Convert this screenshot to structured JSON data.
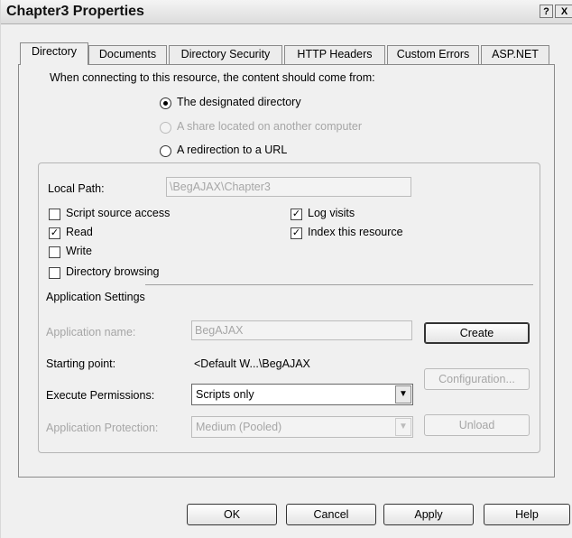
{
  "window": {
    "title": "Chapter3 Properties",
    "help_btn": "?",
    "close_btn": "X"
  },
  "tabs": [
    {
      "label": "Directory",
      "active": true
    },
    {
      "label": "Documents"
    },
    {
      "label": "Directory Security"
    },
    {
      "label": "HTTP Headers"
    },
    {
      "label": "Custom Errors"
    },
    {
      "label": "ASP.NET"
    }
  ],
  "content_source": {
    "prompt": "When connecting to this resource, the content should come from:",
    "options": [
      {
        "label": "The designated directory",
        "selected": true
      },
      {
        "label": "A share located on another computer",
        "disabled": true
      },
      {
        "label": "A redirection to a URL"
      }
    ]
  },
  "local_path": {
    "label": "Local Path:",
    "value": "\\BegAJAX\\Chapter3"
  },
  "checkboxes": [
    {
      "label": "Script source access",
      "checked": false
    },
    {
      "label": "Read",
      "checked": true
    },
    {
      "label": "Write",
      "checked": false
    },
    {
      "label": "Directory browsing",
      "checked": false
    },
    {
      "label": "Log visits",
      "checked": true
    },
    {
      "label": "Index this resource",
      "checked": true
    }
  ],
  "app_settings": {
    "heading": "Application Settings",
    "app_name_label": "Application name:",
    "app_name_value": "BegAJAX",
    "starting_point_label": "Starting point:",
    "starting_point_value": "<Default W...\\BegAJAX",
    "exec_perm_label": "Execute Permissions:",
    "exec_perm_value": "Scripts only",
    "app_protection_label": "Application Protection:",
    "app_protection_value": "Medium (Pooled)",
    "create_btn": "Create",
    "config_btn": "Configuration...",
    "unload_btn": "Unload"
  },
  "footer": {
    "ok": "OK",
    "cancel": "Cancel",
    "apply": "Apply",
    "help": "Help"
  },
  "check_glyph": "✓",
  "dropdown_glyph": "▼"
}
